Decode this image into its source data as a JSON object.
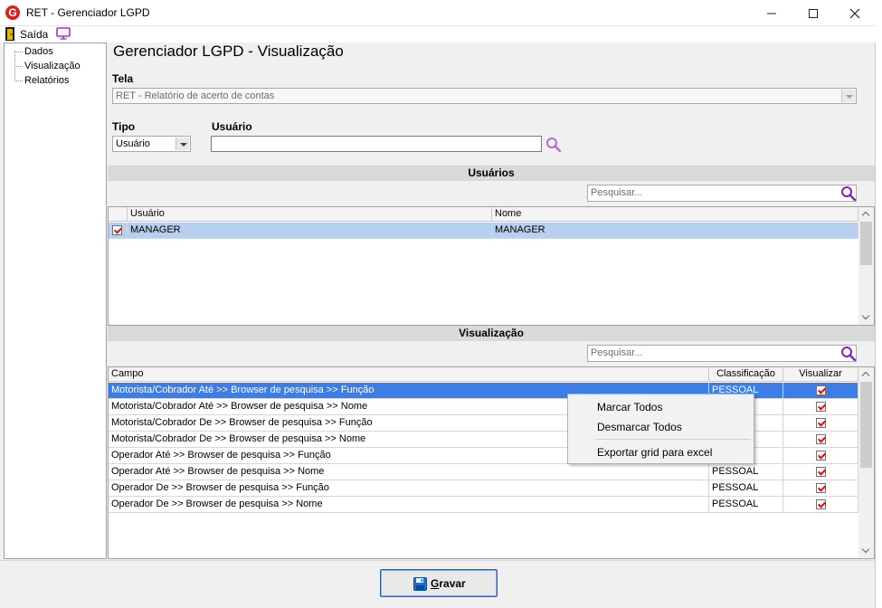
{
  "window": {
    "title": "RET - Gerenciador LGPD",
    "logo_letter": "G"
  },
  "toolbar": {
    "exit_label": "Saída"
  },
  "sidebar": {
    "items": [
      {
        "label": "Dados"
      },
      {
        "label": "Visualização"
      },
      {
        "label": "Relatórios"
      }
    ]
  },
  "main": {
    "title": "Gerenciador LGPD - Visualização",
    "tela_label": "Tela",
    "tela_value": "RET - Relatório de acerto de contas",
    "tipo_label": "Tipo",
    "tipo_value": "Usuário",
    "usuario_label": "Usuário",
    "usuario_value": ""
  },
  "users_section": {
    "header": "Usuários",
    "search_placeholder": "Pesquisar...",
    "columns": [
      "Usuário",
      "Nome"
    ],
    "rows": [
      {
        "checked": true,
        "usuario": "MANAGER",
        "nome": "MANAGER"
      }
    ]
  },
  "view_section": {
    "header": "Visualização",
    "search_placeholder": "Pesquisar...",
    "columns": [
      "Campo",
      "Classificação",
      "Visualizar"
    ],
    "rows": [
      {
        "campo": "Motorista/Cobrador Até >> Browser de pesquisa >> Função",
        "classificacao": "PESSOAL",
        "visualizar": true
      },
      {
        "campo": "Motorista/Cobrador Até >> Browser de pesquisa >> Nome",
        "classificacao": "",
        "visualizar": true
      },
      {
        "campo": "Motorista/Cobrador De >> Browser de pesquisa >> Função",
        "classificacao": "",
        "visualizar": true
      },
      {
        "campo": "Motorista/Cobrador De >> Browser de pesquisa >> Nome",
        "classificacao": "",
        "visualizar": true
      },
      {
        "campo": "Operador Até >> Browser de pesquisa >> Função",
        "classificacao": "",
        "visualizar": true
      },
      {
        "campo": "Operador Até >> Browser de pesquisa >> Nome",
        "classificacao": "PESSOAL",
        "visualizar": true
      },
      {
        "campo": "Operador De >> Browser de pesquisa >> Função",
        "classificacao": "PESSOAL",
        "visualizar": true
      },
      {
        "campo": "Operador De >> Browser de pesquisa >> Nome",
        "classificacao": "PESSOAL",
        "visualizar": true
      }
    ]
  },
  "context_menu": {
    "items": [
      "Marcar Todos",
      "Desmarcar Todos",
      "Exportar grid para excel"
    ]
  },
  "footer": {
    "save_label_first": "G",
    "save_label_rest": "ravar"
  },
  "colors": {
    "selection": "#3d7ee6",
    "accent_icon": "#9b30d9",
    "check": "#d11111"
  }
}
